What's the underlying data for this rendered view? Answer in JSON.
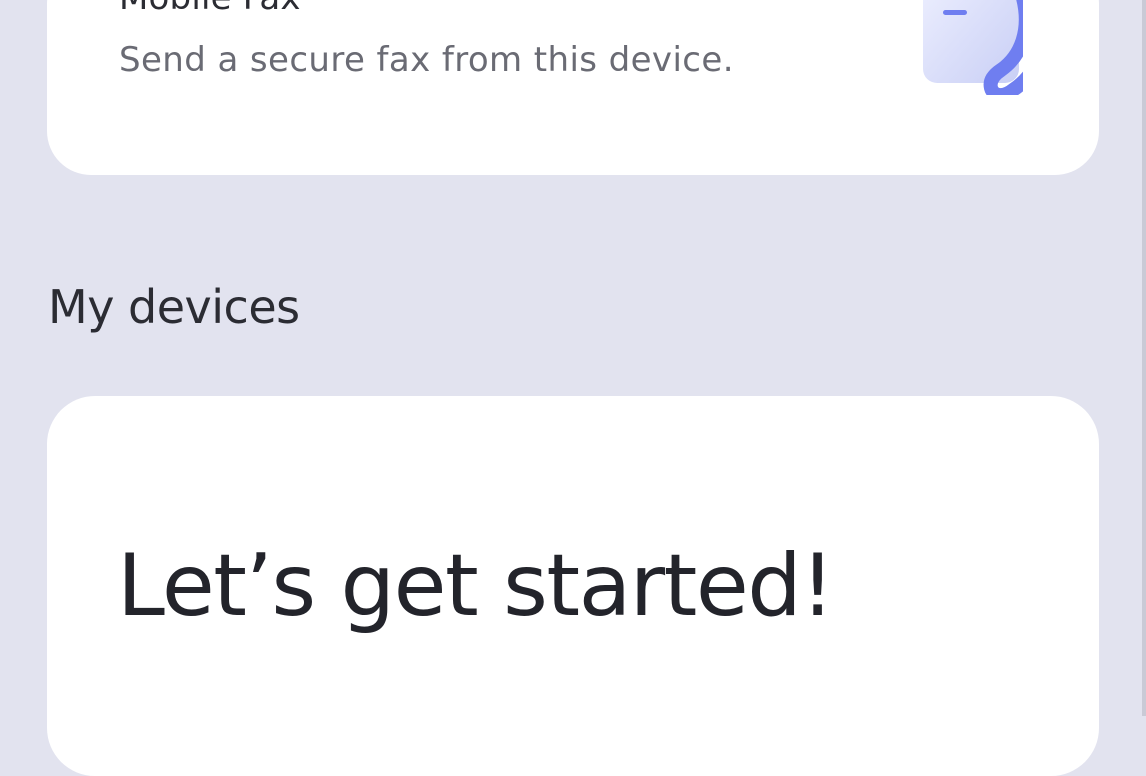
{
  "fax_card": {
    "title": "Mobile Fax",
    "subtitle": "Send a secure fax from this device.",
    "icon": "fax-phone-icon"
  },
  "devices_section": {
    "title": "My devices"
  },
  "devices_card": {
    "hero_text": "Let’s get started!"
  },
  "colors": {
    "background": "#e2e3ef",
    "card": "#ffffff",
    "text_primary": "#2b2c33",
    "text_secondary": "#6a6b74",
    "accent": "#6f7ef0"
  }
}
